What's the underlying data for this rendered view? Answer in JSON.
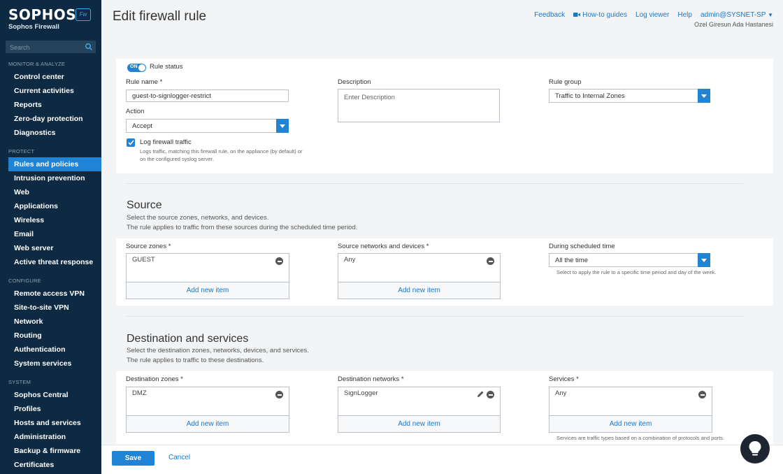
{
  "brand": {
    "logo": "SOPHOS",
    "product": "Sophos Firewall",
    "badge": "Fw"
  },
  "search": {
    "placeholder": "Search"
  },
  "nav": {
    "monitor_title": "MONITOR & ANALYZE",
    "monitor": [
      "Control center",
      "Current activities",
      "Reports",
      "Zero-day protection",
      "Diagnostics"
    ],
    "protect_title": "PROTECT",
    "protect": [
      "Rules and policies",
      "Intrusion prevention",
      "Web",
      "Applications",
      "Wireless",
      "Email",
      "Web server",
      "Active threat response"
    ],
    "configure_title": "CONFIGURE",
    "configure": [
      "Remote access VPN",
      "Site-to-site VPN",
      "Network",
      "Routing",
      "Authentication",
      "System services"
    ],
    "system_title": "SYSTEM",
    "system": [
      "Sophos Central",
      "Profiles",
      "Hosts and services",
      "Administration",
      "Backup & firmware",
      "Certificates"
    ]
  },
  "header": {
    "title": "Edit firewall rule",
    "feedback": "Feedback",
    "howto": "How-to guides",
    "logviewer": "Log viewer",
    "help": "Help",
    "user": "admin@SYSNET-SP",
    "org": "Ozel Giresun Ada Hastanesi"
  },
  "rule": {
    "toggle_text": "ON",
    "status_label": "Rule status",
    "name_label": "Rule name *",
    "name_value": "guest-to-signlogger-restrict",
    "desc_label": "Description",
    "desc_placeholder": "Enter Description",
    "group_label": "Rule group",
    "group_value": "Traffic to Internal Zones",
    "action_label": "Action",
    "action_value": "Accept",
    "log_label": "Log firewall traffic",
    "log_hint_1": "Logs traffic, matching this firewall rule, on the appliance (by default) or",
    "log_hint_2": "on the configured syslog server."
  },
  "source": {
    "title": "Source",
    "desc_1": "Select the source zones, networks, and devices.",
    "desc_2": "The rule applies to traffic from these sources during the scheduled time period.",
    "zones_label": "Source zones *",
    "zones_value": "GUEST",
    "networks_label": "Source networks and devices *",
    "networks_value": "Any",
    "schedule_label": "During scheduled time",
    "schedule_value": "All the time",
    "schedule_hint": "Select to apply the rule to a specific time period and day of the week.",
    "add_new": "Add new item"
  },
  "destination": {
    "title": "Destination and services",
    "desc_1": "Select the destination zones, networks, devices, and services.",
    "desc_2": "The rule applies to traffic to these destinations.",
    "zones_label": "Destination zones *",
    "zones_value": "DMZ",
    "networks_label": "Destination networks *",
    "networks_value": "SignLogger",
    "services_label": "Services *",
    "services_value": "Any",
    "services_hint": "Services are traffic types based on a combination of protocols and ports.",
    "add_new": "Add new item"
  },
  "footer": {
    "save": "Save",
    "cancel": "Cancel"
  }
}
